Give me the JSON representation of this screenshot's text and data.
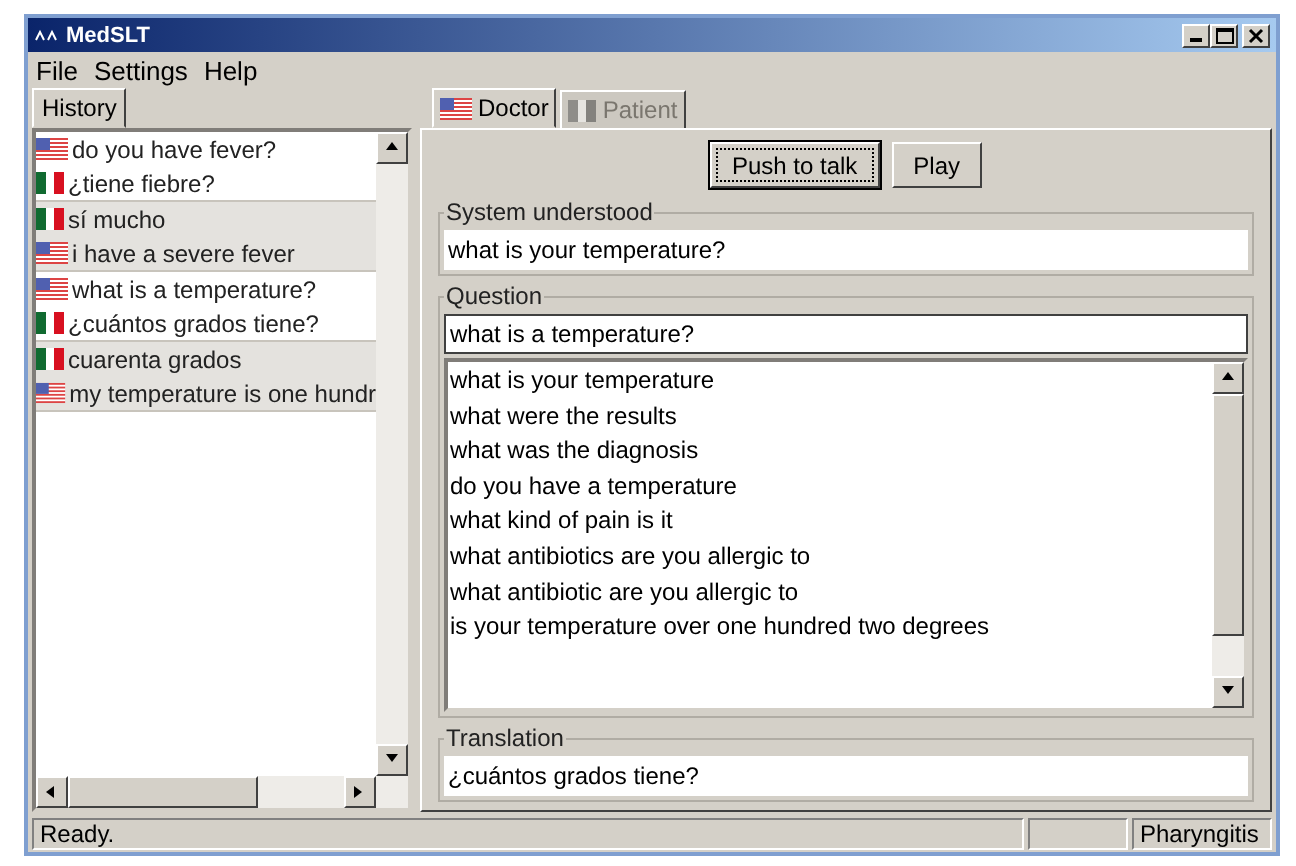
{
  "window": {
    "title": "MedSLT"
  },
  "menu": [
    "File",
    "Settings",
    "Help"
  ],
  "history": {
    "tab": "History",
    "groups": [
      {
        "items": [
          {
            "kind": "us",
            "text": "do you have fever?"
          },
          {
            "kind": "mx",
            "text": "¿tiene fiebre?"
          }
        ]
      },
      {
        "items": [
          {
            "kind": "mx",
            "text": "sí mucho"
          },
          {
            "kind": "us",
            "text": "i have a severe fever"
          }
        ]
      },
      {
        "items": [
          {
            "kind": "us",
            "text": "what is a temperature?"
          },
          {
            "kind": "mx",
            "text": "¿cuántos grados tiene?"
          }
        ]
      },
      {
        "items": [
          {
            "kind": "mx",
            "text": "cuarenta grados"
          },
          {
            "kind": "us",
            "text": "my temperature is one hundr"
          }
        ]
      }
    ]
  },
  "tabs": [
    {
      "label": "Doctor",
      "kind": "us",
      "selected": true,
      "disabled": false
    },
    {
      "label": "Patient",
      "kind": "mx",
      "selected": false,
      "disabled": true
    }
  ],
  "buttons": [
    {
      "label": "Push to talk",
      "focused": true
    },
    {
      "label": "Play",
      "focused": false
    }
  ],
  "system_understood": {
    "label": "System understood",
    "value": "what is your temperature?"
  },
  "question": {
    "label": "Question",
    "value": "what is a temperature?",
    "suggestions": [
      "what is your temperature",
      "what were the results",
      "what was the diagnosis",
      "do you have a temperature",
      "what kind of pain is it",
      "what antibiotics are you allergic to",
      "what antibiotic are you allergic to",
      "is your temperature over one hundred two degrees"
    ]
  },
  "translation": {
    "label": "Translation",
    "value": "¿cuántos grados tiene?"
  },
  "status_bar": [
    "Ready.",
    "Pharyngitis"
  ]
}
